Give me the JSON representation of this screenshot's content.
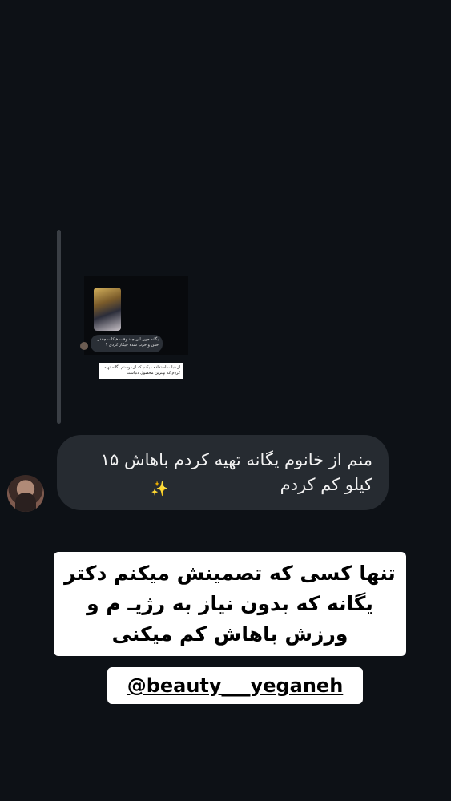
{
  "quoted_story": {
    "bubble_text": "یگانه جون این چند وقت هیکلت چقدر خفن و خوب شده چیکار کردی ؟",
    "note_text": "از قبلت استفاده میکنم که از دوستم یگانه تهیه کردم که بهترین محصول دنیاست"
  },
  "reply": {
    "message": "منم از خانوم یگانه تهیه کردم باهاش ۱۵ کیلو کم کردم",
    "emoji": "✨"
  },
  "caption": {
    "text": "تنها کسی که تصمینش میکنم دکتر یگانه که بدون نیاز به رژیـ م و ورزش باهاش کم میکنی"
  },
  "mention": {
    "handle": "@beauty___yeganeh"
  },
  "colors": {
    "background": "#0d1116",
    "bubble": "#262b31",
    "caption_bg": "#ffffff"
  }
}
